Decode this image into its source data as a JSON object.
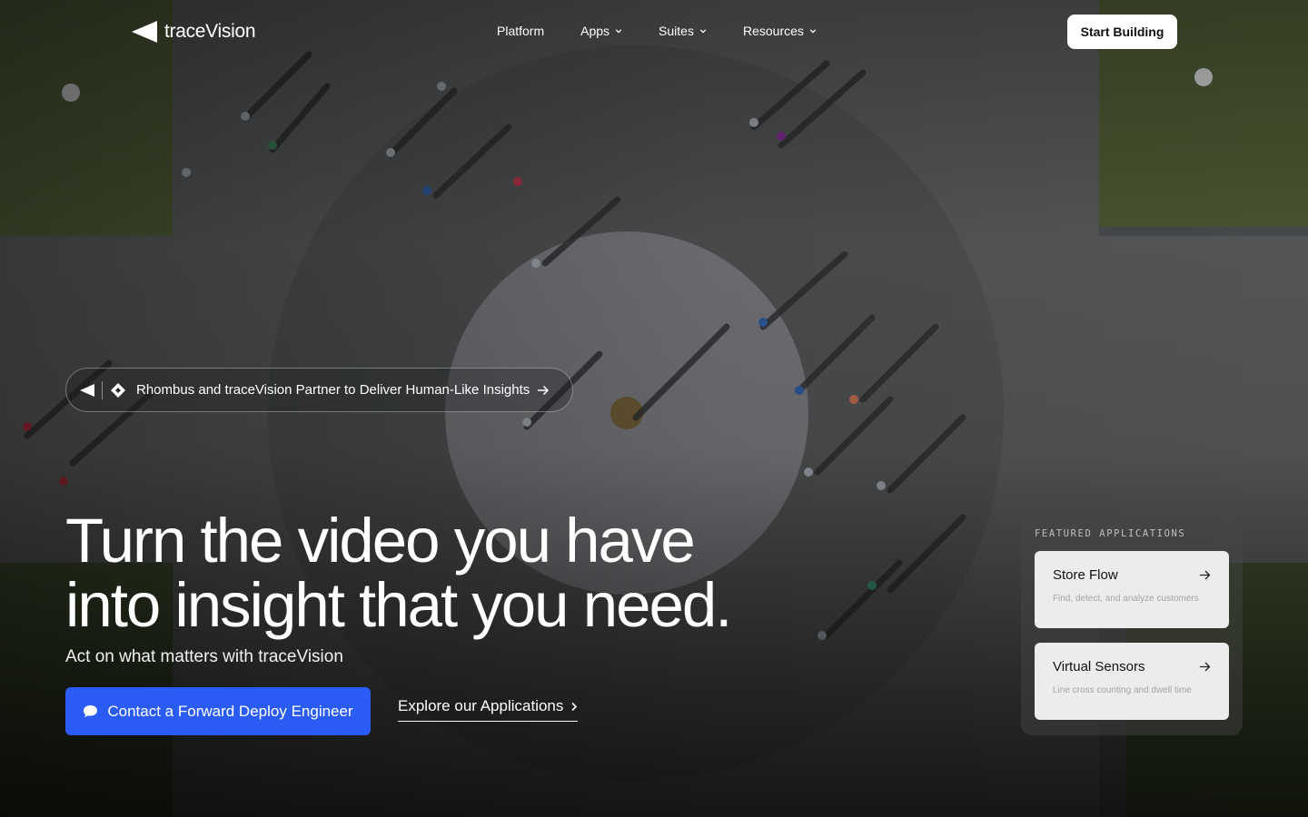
{
  "brand": {
    "name": "traceVision",
    "logo_icon": "tracevision-logo-icon"
  },
  "nav": {
    "items": [
      {
        "label": "Platform",
        "has_dropdown": false
      },
      {
        "label": "Apps",
        "has_dropdown": true
      },
      {
        "label": "Suites",
        "has_dropdown": true
      },
      {
        "label": "Resources",
        "has_dropdown": true
      }
    ],
    "cta_label": "Start Building"
  },
  "announcement": {
    "text": "Rhombus and traceVision Partner to Deliver Human-Like Insights",
    "icons": [
      "tracevision-logo-icon",
      "rhombus-logo-icon",
      "arrow-right-icon"
    ]
  },
  "hero": {
    "title_line1": "Turn the video you have",
    "title_line2": "into insight that you need.",
    "subtitle": "Act on what matters with traceVision",
    "primary_cta": "Contact a Forward Deploy Engineer",
    "primary_cta_icon": "chat-bubble-icon",
    "secondary_cta": "Explore our Applications",
    "secondary_cta_icon": "chevron-right-icon"
  },
  "featured": {
    "label": "FEATURED APPLICATIONS",
    "apps": [
      {
        "title": "Store Flow",
        "description": "Find, detect, and analyze customers"
      },
      {
        "title": "Virtual Sensors",
        "description": "Line cross counting and dwell time"
      }
    ]
  },
  "colors": {
    "primary_button": "#2a5cf5",
    "card_bg": "#ececec",
    "text": "#ffffff"
  }
}
